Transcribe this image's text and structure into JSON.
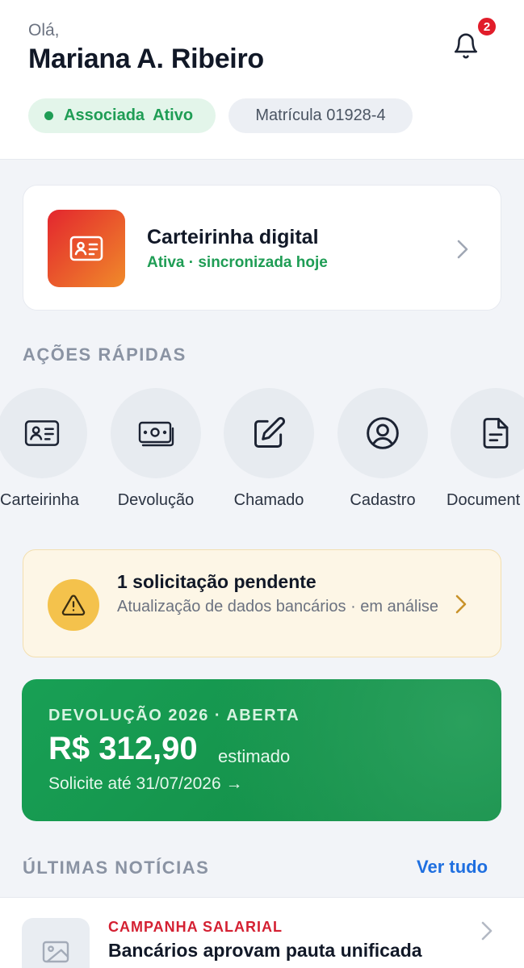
{
  "header": {
    "greeting": "Olá,",
    "user_name": "Mariana A. Ribeiro",
    "notifications_count": "2",
    "status_label_1": "Associada",
    "status_label_2": "Ativo",
    "registration": "Matrícula 01928-4"
  },
  "digital_card": {
    "title": "Carteirinha digital",
    "status": "Ativa · sincronizada hoje"
  },
  "quick_actions": {
    "title": "AÇÕES RÁPIDAS",
    "items": [
      {
        "label": "Carteirinha",
        "icon": "id-card-icon"
      },
      {
        "label": "Devolução",
        "icon": "money-icon"
      },
      {
        "label": "Chamado",
        "icon": "edit-icon"
      },
      {
        "label": "Cadastro",
        "icon": "user-circle-icon"
      },
      {
        "label": "Document",
        "icon": "document-icon"
      }
    ]
  },
  "pending": {
    "title": "1 solicitação pendente",
    "description": "Atualização de dados bancários · em análise"
  },
  "refund": {
    "eyebrow": "DEVOLUÇÃO 2026 · ABERTA",
    "amount": "R$ 312,90",
    "amount_note": "estimado",
    "deadline": "Solicite até 31/07/2026 →"
  },
  "news": {
    "title": "ÚLTIMAS NOTÍCIAS",
    "see_all": "Ver tudo",
    "items": [
      {
        "tag": "CAMPANHA SALARIAL",
        "headline": "Bancários aprovam pauta unificada"
      }
    ]
  },
  "colors": {
    "accent_green": "#1f9d55",
    "link_blue": "#1f6fe0",
    "alert_red": "#e11d2a",
    "warning_yellow": "#f4c24c"
  }
}
